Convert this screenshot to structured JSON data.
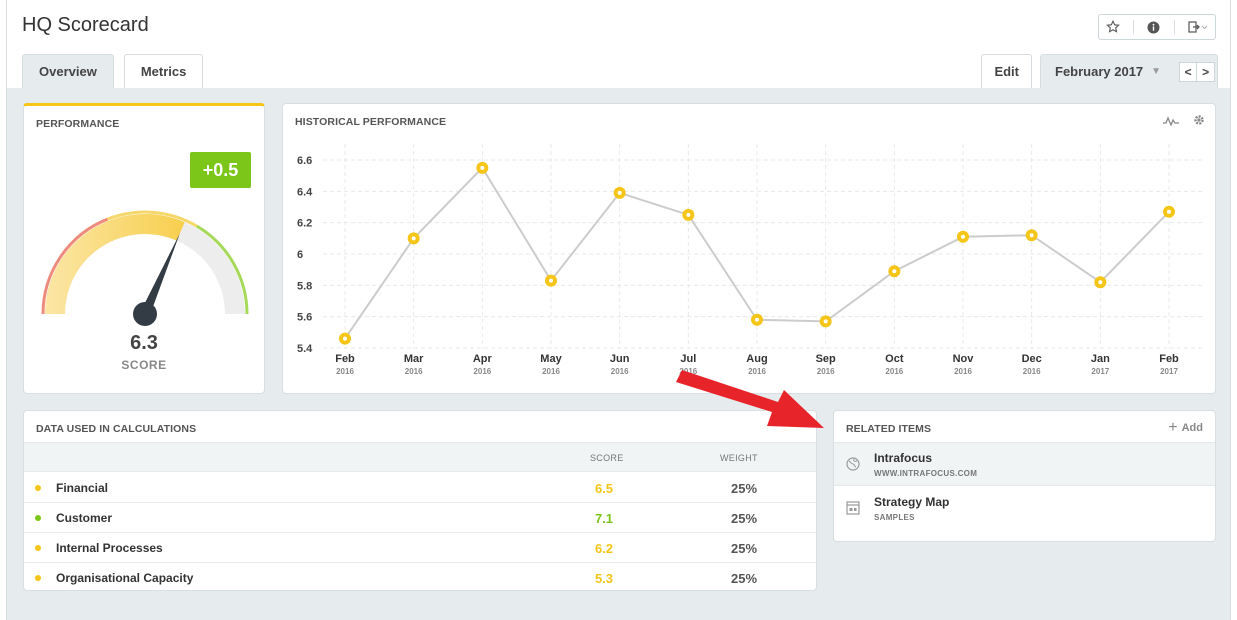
{
  "header": {
    "title": "HQ Scorecard",
    "icons": [
      "star-icon",
      "info-icon",
      "export-icon"
    ]
  },
  "tabs": [
    {
      "label": "Overview",
      "active": true
    },
    {
      "label": "Metrics",
      "active": false
    }
  ],
  "controls": {
    "edit_label": "Edit",
    "period": "February 2017",
    "prev": "<",
    "next": ">"
  },
  "performance": {
    "title": "PERFORMANCE",
    "delta": "+0.5",
    "score": "6.3",
    "score_label": "SCORE",
    "gauge_value": 6.3,
    "gauge_min": 0,
    "gauge_max": 10,
    "delta_color": "#7cc61a"
  },
  "historical": {
    "title": "HISTORICAL PERFORMANCE",
    "icons": [
      "trend-icon",
      "gear-icon"
    ]
  },
  "chart_data": {
    "type": "line",
    "categories": [
      {
        "month": "Feb",
        "year": "2016"
      },
      {
        "month": "Mar",
        "year": "2016"
      },
      {
        "month": "Apr",
        "year": "2016"
      },
      {
        "month": "May",
        "year": "2016"
      },
      {
        "month": "Jun",
        "year": "2016"
      },
      {
        "month": "Jul",
        "year": "2016"
      },
      {
        "month": "Aug",
        "year": "2016"
      },
      {
        "month": "Sep",
        "year": "2016"
      },
      {
        "month": "Oct",
        "year": "2016"
      },
      {
        "month": "Nov",
        "year": "2016"
      },
      {
        "month": "Dec",
        "year": "2016"
      },
      {
        "month": "Jan",
        "year": "2017"
      },
      {
        "month": "Feb",
        "year": "2017"
      }
    ],
    "values": [
      5.46,
      6.1,
      6.55,
      5.83,
      6.39,
      6.25,
      5.58,
      5.57,
      5.89,
      6.11,
      6.12,
      5.82,
      6.27
    ],
    "yticks": [
      "6.6",
      "6.4",
      "6.2",
      "6",
      "5.8",
      "5.6",
      "5.4"
    ],
    "ylim": [
      5.4,
      6.6
    ],
    "grid": true,
    "line_color": "#cccccc",
    "point_color": "#f5c518"
  },
  "data_table": {
    "title": "DATA USED IN CALCULATIONS",
    "columns": [
      "SCORE",
      "WEIGHT"
    ],
    "rows": [
      {
        "name": "Financial",
        "score": "6.5",
        "weight": "25%",
        "color": "#f5c518"
      },
      {
        "name": "Customer",
        "score": "7.1",
        "weight": "25%",
        "color": "#7cc61a"
      },
      {
        "name": "Internal Processes",
        "score": "6.2",
        "weight": "25%",
        "color": "#f5c518"
      },
      {
        "name": "Organisational Capacity",
        "score": "5.3",
        "weight": "25%",
        "color": "#f5c518"
      }
    ]
  },
  "related": {
    "title": "RELATED ITEMS",
    "add_label": "Add",
    "items": [
      {
        "name": "Intrafocus",
        "sub": "WWW.INTRAFOCUS.COM",
        "icon": "globe-icon"
      },
      {
        "name": "Strategy Map",
        "sub": "SAMPLES",
        "icon": "strategy-map-icon"
      }
    ]
  },
  "annotation": {
    "color": "#e8242b"
  }
}
